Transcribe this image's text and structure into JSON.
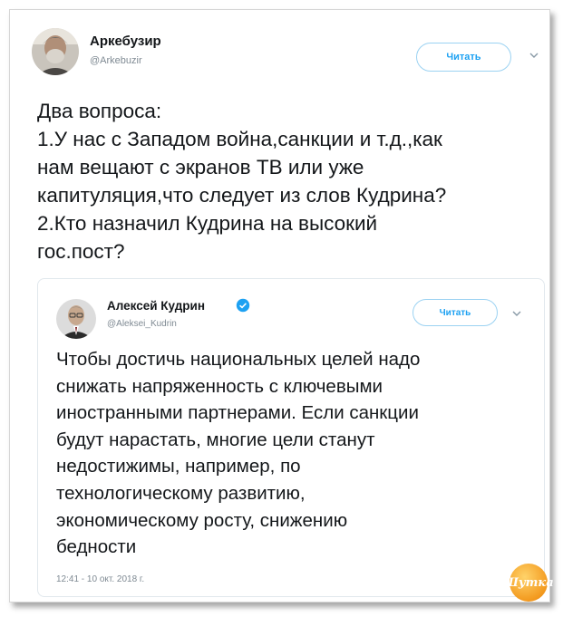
{
  "tweet": {
    "author_name": "Аркебузир",
    "author_handle": "@Arkebuzir",
    "follow_label": "Читать",
    "text_lines": [
      "Два вопроса:",
      "1.У нас с Западом война,санкции и т.д.,как",
      "нам вещают с экранов ТВ или уже",
      "капитуляция,что следует из слов Кудрина?",
      "2.Кто назначил Кудрина на высокий",
      "гос.пост?"
    ]
  },
  "quoted_tweet": {
    "author_name": "Алексей Кудрин",
    "author_handle": "@Aleksei_Kudrin",
    "follow_label": "Читать",
    "text_lines": [
      "Чтобы достичь национальных целей надо",
      "снижать напряженность с ключевыми",
      "иностранными партнерами. Если санкции",
      "будут нарастать, многие цели станут",
      "недостижимы, например, по",
      "технологическому развитию,",
      "экономическому росту, снижению",
      "бедности"
    ],
    "timestamp": "12:41 - 10 окт. 2018 г."
  },
  "watermark": {
    "text": "Шутка"
  },
  "colors": {
    "accent": "#1da1f2",
    "muted": "#7f8a93",
    "verified": "#1da1f2"
  },
  "icons": {
    "chevron": "chevron-down-icon",
    "verified": "verified-badge-icon"
  }
}
